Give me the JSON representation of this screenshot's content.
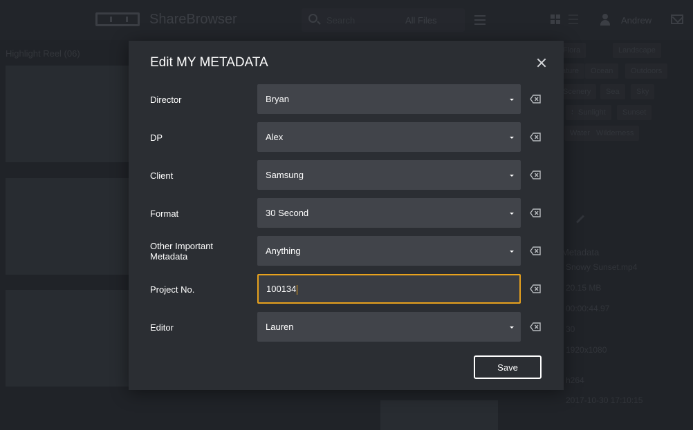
{
  "app": {
    "name": "ShareBrowser",
    "search_placeholder": "Search",
    "scope": "All Files",
    "user": "Andrew"
  },
  "background": {
    "reel_title": "Highlight Reel (06)",
    "tags": [
      "Flora",
      "Landscape",
      "Nature",
      "Ocean",
      "Outdoors",
      "Scenery",
      "Sea",
      "Sky",
      "Snow",
      "Sunlight",
      "Sunset",
      "Water",
      "Wilderness"
    ],
    "metadata_heading": "Metadata",
    "metadata_values": [
      "Snowy Sunset.mp4",
      "20.15 MB",
      "00:00:44.97",
      "30",
      "1920x1080",
      "h264",
      "2017-10-30 17:10:15"
    ]
  },
  "modal": {
    "title": "Edit MY METADATA",
    "close_icon": "close-icon",
    "fields": [
      {
        "label": "Director",
        "value": "Bryan",
        "type": "dropdown"
      },
      {
        "label": "DP",
        "value": "Alex",
        "type": "dropdown"
      },
      {
        "label": "Client",
        "value": "Samsung",
        "type": "dropdown"
      },
      {
        "label": "Format",
        "value": "30 Second",
        "type": "dropdown"
      },
      {
        "label": "Other Important Metadata",
        "value": "Anything",
        "type": "dropdown"
      },
      {
        "label": "Project No.",
        "value": "100134",
        "type": "text"
      },
      {
        "label": "Editor",
        "value": "Lauren",
        "type": "dropdown"
      }
    ],
    "clear_icon": "backspace-clear-icon",
    "save_label": "Save"
  },
  "colors": {
    "modal_bg": "#2b2e33",
    "field_bg": "#41444a",
    "focus_accent": "#e8a21d",
    "text": "#ffffff"
  }
}
